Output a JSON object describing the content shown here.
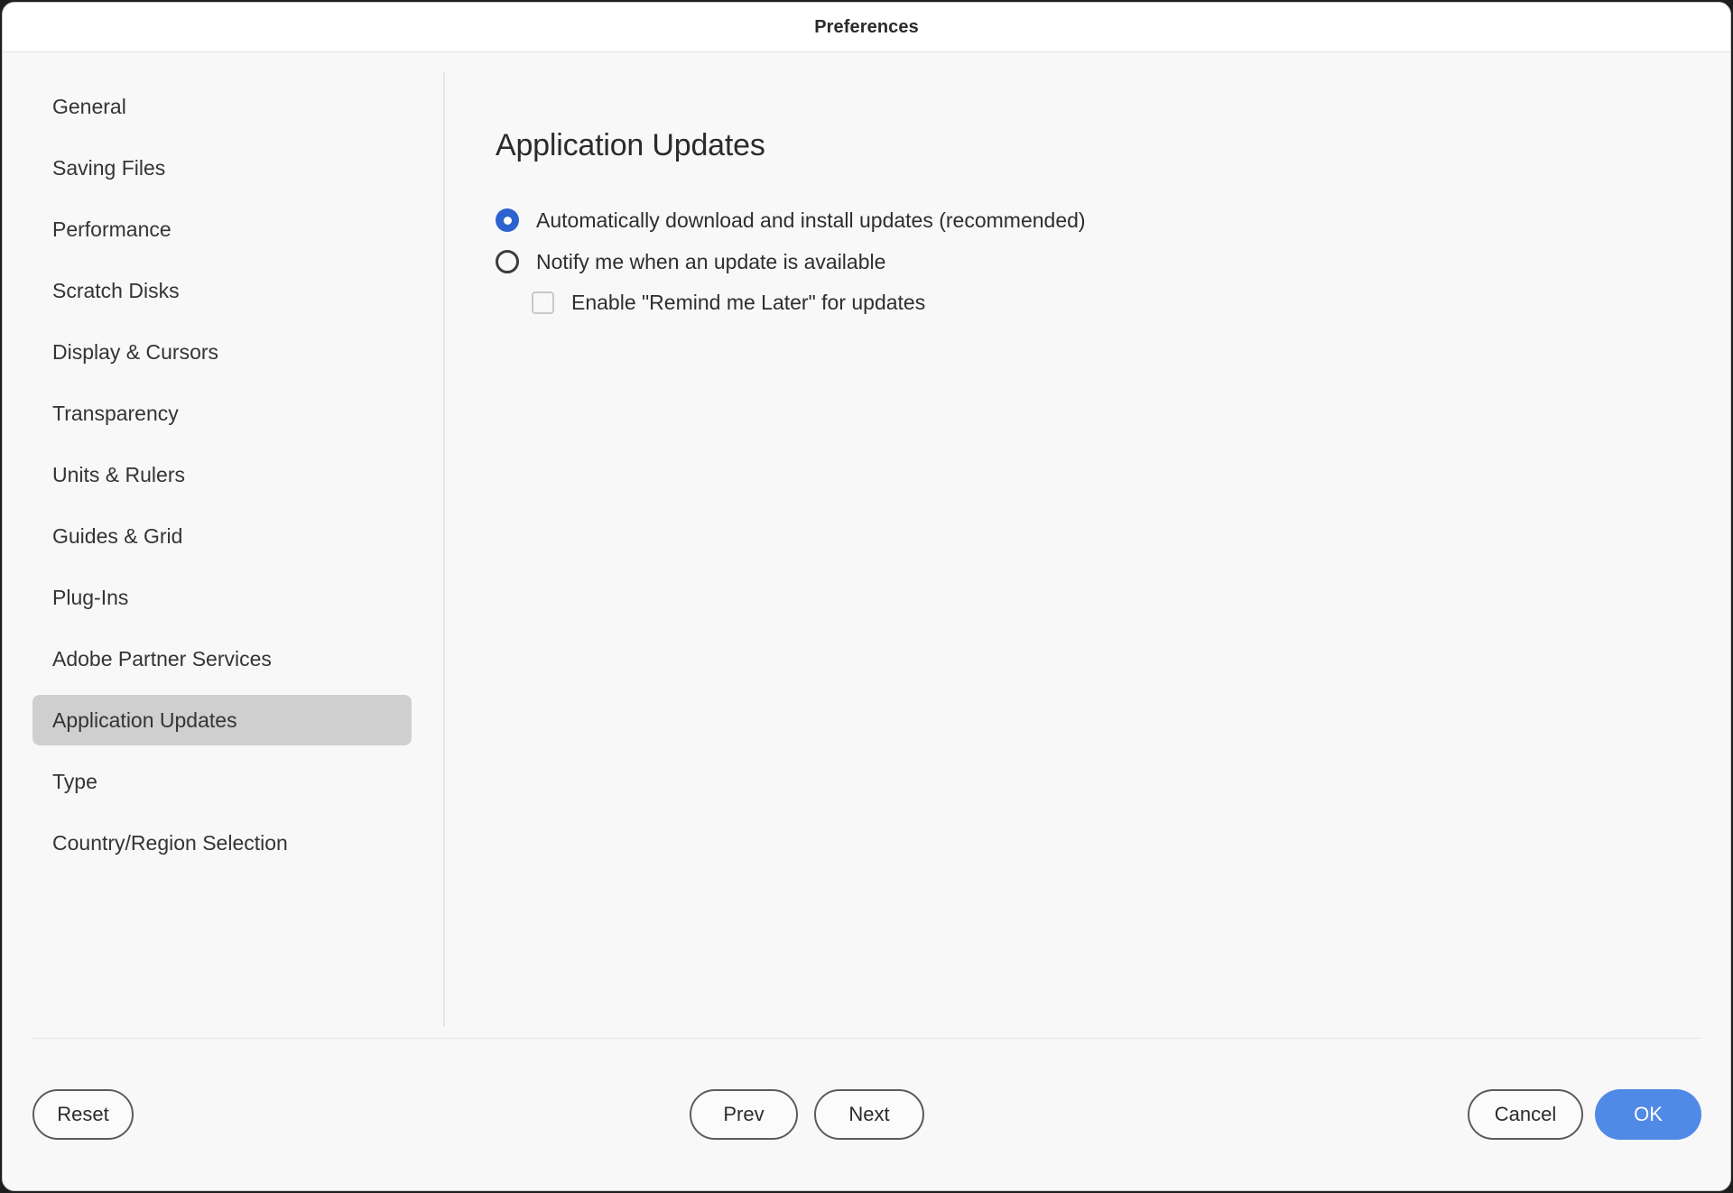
{
  "window": {
    "title": "Preferences"
  },
  "sidebar": {
    "items": [
      {
        "label": "General",
        "selected": false
      },
      {
        "label": "Saving Files",
        "selected": false
      },
      {
        "label": "Performance",
        "selected": false
      },
      {
        "label": "Scratch Disks",
        "selected": false
      },
      {
        "label": "Display & Cursors",
        "selected": false
      },
      {
        "label": "Transparency",
        "selected": false
      },
      {
        "label": "Units & Rulers",
        "selected": false
      },
      {
        "label": "Guides & Grid",
        "selected": false
      },
      {
        "label": "Plug-Ins",
        "selected": false
      },
      {
        "label": "Adobe Partner Services",
        "selected": false
      },
      {
        "label": "Application Updates",
        "selected": true
      },
      {
        "label": "Type",
        "selected": false
      },
      {
        "label": "Country/Region Selection",
        "selected": false
      }
    ]
  },
  "content": {
    "title": "Application Updates",
    "options": [
      {
        "type": "radio",
        "label": "Automatically download and install updates (recommended)",
        "checked": true
      },
      {
        "type": "radio",
        "label": "Notify me when an update is available",
        "checked": false
      },
      {
        "type": "checkbox",
        "label": "Enable \"Remind me Later\" for updates",
        "checked": false
      }
    ]
  },
  "footer": {
    "reset_label": "Reset",
    "prev_label": "Prev",
    "next_label": "Next",
    "cancel_label": "Cancel",
    "ok_label": "OK"
  },
  "colors": {
    "accent_primary": "#5089e6",
    "radio_selected": "#2c63cf",
    "sidebar_selected_bg": "#cfcfcf",
    "window_bg": "#f8f8f8",
    "titlebar_bg": "#ffffff"
  }
}
